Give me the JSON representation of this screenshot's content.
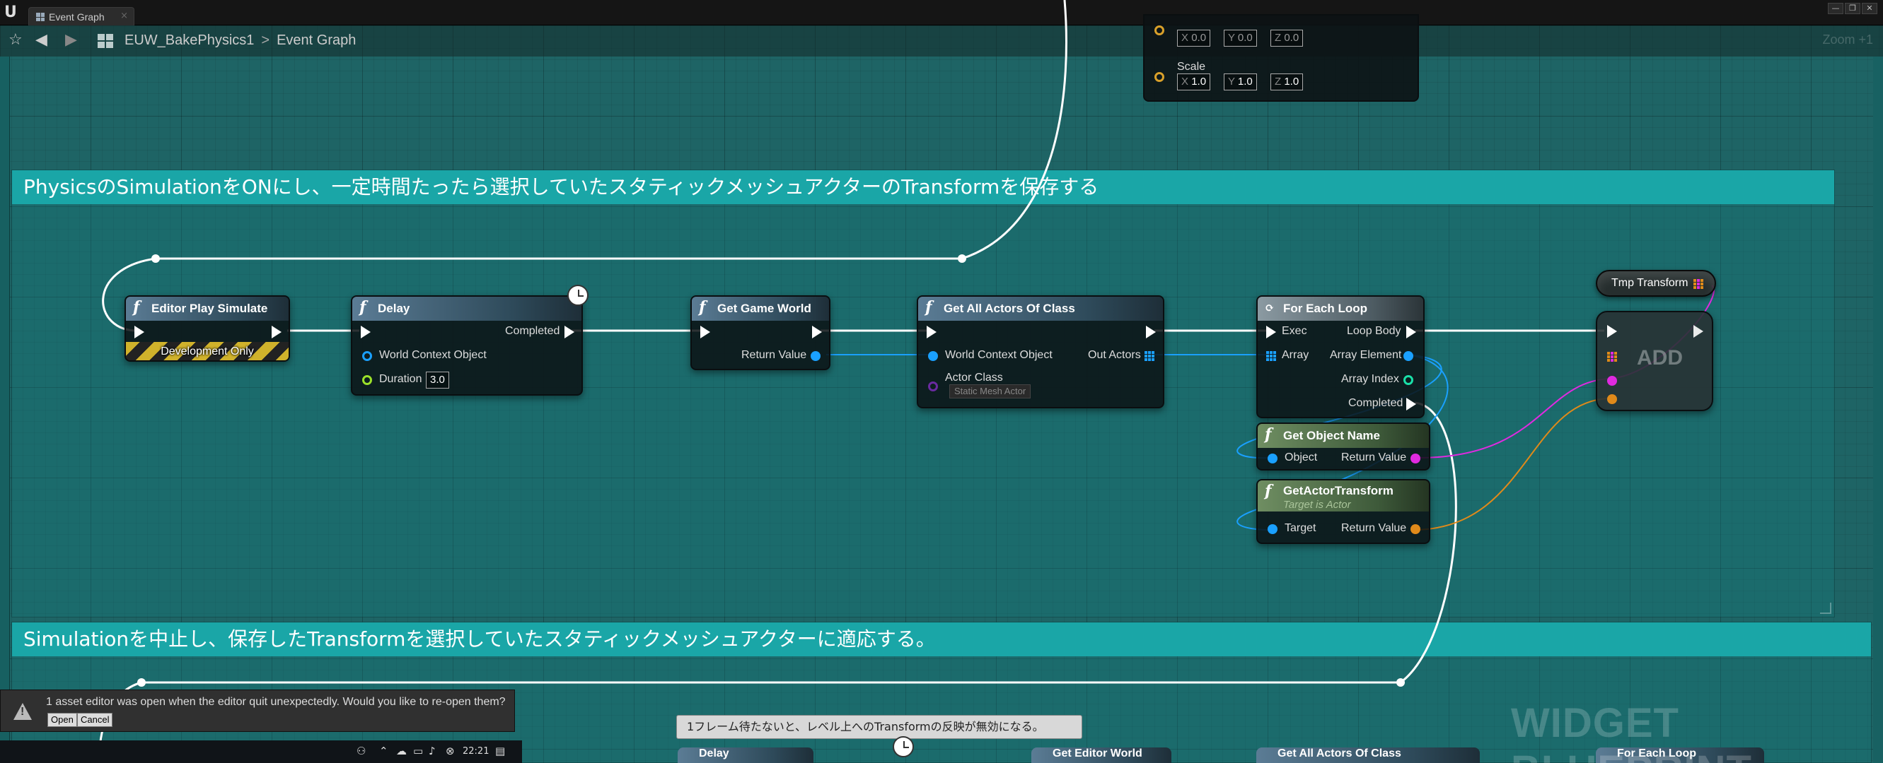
{
  "window": {
    "tab_label": "Event Graph",
    "tab_close": "×",
    "controls": [
      "—",
      "❐",
      "✕"
    ]
  },
  "toolbar": {
    "star": "☆",
    "back": "◀",
    "forward": "▶",
    "breadcrumb": [
      "EUW_BakePhysics1",
      "Event Graph"
    ],
    "breadcrumb_sep": ">",
    "zoom": "Zoom +1"
  },
  "comments": [
    {
      "text": "PhysicsのSimulationをONにし、一定時間たったら選択していたスタティックメッシュアクターのTransformを保存する"
    },
    {
      "text": "Simulationを中止し、保存したTransformを選択していたスタティックメッシュアクターに適応する。"
    }
  ],
  "transform_node": {
    "rows": [
      {
        "x": "0.0",
        "y": "0.0",
        "z": "0.0"
      },
      {
        "label": "Scale",
        "x": "1.0",
        "y": "1.0",
        "z": "1.0"
      }
    ],
    "axes": [
      "X",
      "Y",
      "Z"
    ]
  },
  "nodes": {
    "editor_play_simulate": {
      "title": "Editor Play Simulate",
      "footer": "Development Only"
    },
    "delay": {
      "title": "Delay",
      "completed": "Completed",
      "world_context": "World Context Object",
      "duration_label": "Duration",
      "duration_value": "3.0"
    },
    "get_game_world": {
      "title": "Get Game World",
      "return_value": "Return Value"
    },
    "get_all_actors": {
      "title": "Get All Actors Of Class",
      "world_context": "World Context Object",
      "out_actors": "Out Actors",
      "actor_class": "Actor Class",
      "class_value": "Static Mesh Actor"
    },
    "for_each_loop": {
      "title": "For Each Loop",
      "exec": "Exec",
      "loop_body": "Loop Body",
      "array": "Array",
      "array_element": "Array Element",
      "array_index": "Array Index",
      "completed": "Completed"
    },
    "get_object_name": {
      "title": "Get Object Name",
      "object": "Object",
      "return_value": "Return Value"
    },
    "get_actor_transform": {
      "title": "GetActorTransform",
      "subtitle": "Target is Actor",
      "target": "Target",
      "return_value": "Return Value"
    },
    "tmp_transform": {
      "label": "Tmp Transform"
    },
    "add": {
      "label": "ADD"
    }
  },
  "bottom": {
    "tooltip": "1フレーム待たないと、レベル上へのTransformの反映が無効になる。",
    "nodes": [
      "Delay",
      "Get Editor World",
      "Get All Actors Of Class",
      "For Each Loop"
    ]
  },
  "watermark": "WIDGET BLUEPRINT",
  "notification": {
    "message": "1 asset editor was open when the editor quit unexpectedly. Would you like to re-open them?",
    "open": "Open",
    "cancel": "Cancel"
  },
  "taskbar": {
    "time": "22:21"
  }
}
